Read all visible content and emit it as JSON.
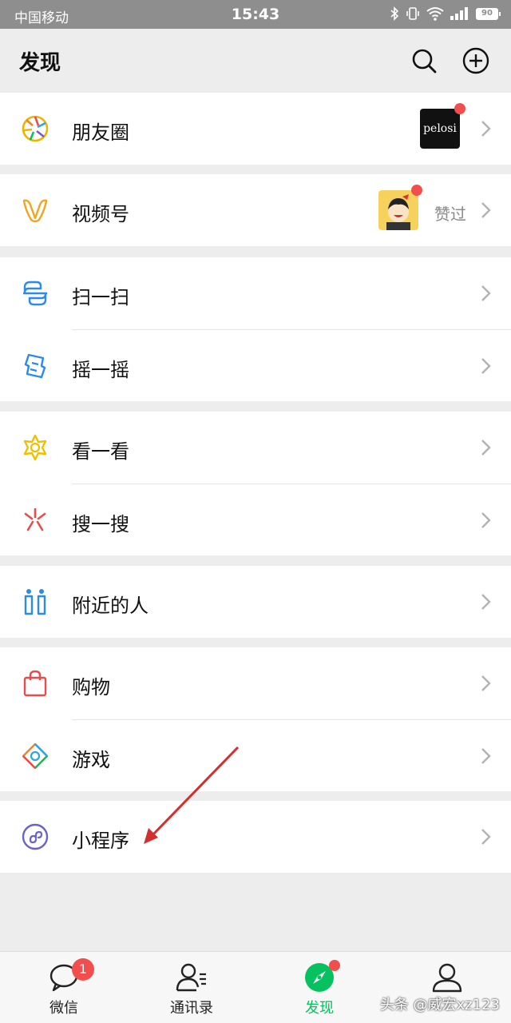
{
  "status_bar": {
    "carrier": "中国移动",
    "time": "15:43",
    "battery": "90"
  },
  "header": {
    "title": "发现"
  },
  "groups": [
    {
      "items": [
        {
          "label": "朋友圈",
          "thumb_text": "pelosi"
        }
      ]
    },
    {
      "items": [
        {
          "label": "视频号",
          "sub": "赞过"
        }
      ]
    },
    {
      "items": [
        {
          "label": "扫一扫"
        },
        {
          "label": "摇一摇"
        }
      ]
    },
    {
      "items": [
        {
          "label": "看一看"
        },
        {
          "label": "搜一搜"
        }
      ]
    },
    {
      "items": [
        {
          "label": "附近的人"
        }
      ]
    },
    {
      "items": [
        {
          "label": "购物"
        },
        {
          "label": "游戏"
        }
      ]
    },
    {
      "items": [
        {
          "label": "小程序"
        }
      ]
    }
  ],
  "tabbar": {
    "tabs": [
      {
        "label": "微信",
        "badge": "1"
      },
      {
        "label": "通讯录"
      },
      {
        "label": "发现"
      },
      {
        "label": "我"
      }
    ]
  },
  "watermark": "头条 @威宏xz123",
  "colors": {
    "accent": "#07c160",
    "badge": "#f24e4e",
    "arrow": "#d32f2f"
  }
}
